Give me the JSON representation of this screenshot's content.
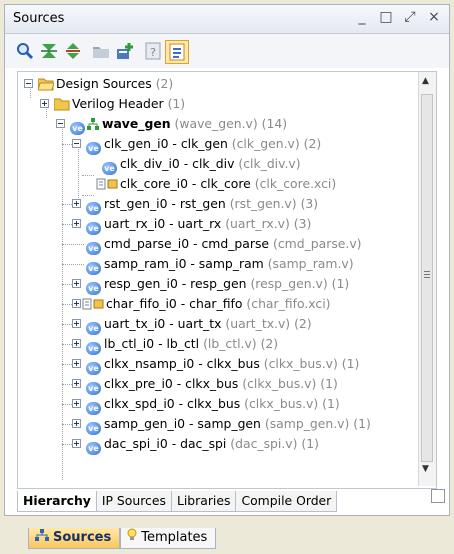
{
  "panel": {
    "title": "Sources"
  },
  "window_buttons": [
    "_",
    "□",
    "⤢",
    "×"
  ],
  "tree": {
    "design_sources": {
      "label": "Design Sources",
      "count": "(2)"
    },
    "verilog_header": {
      "label": "Verilog Header",
      "count": "(1)"
    },
    "top": {
      "name": "wave_gen",
      "file": "(wave_gen.v)",
      "count": "(14)"
    },
    "children": [
      {
        "name": "clk_gen_i0 - clk_gen",
        "file": "(clk_gen.v)",
        "count": "(2)"
      },
      {
        "name": "clk_div_i0 - clk_div",
        "file": "(clk_div.v)",
        "count": ""
      },
      {
        "name": "clk_core_i0 - clk_core",
        "file": "(clk_core.xci)",
        "count": ""
      },
      {
        "name": "rst_gen_i0 - rst_gen",
        "file": "(rst_gen.v)",
        "count": "(3)"
      },
      {
        "name": "uart_rx_i0 - uart_rx",
        "file": "(uart_rx.v)",
        "count": "(3)"
      },
      {
        "name": "cmd_parse_i0 - cmd_parse",
        "file": "(cmd_parse.v)",
        "count": ""
      },
      {
        "name": "samp_ram_i0 - samp_ram",
        "file": "(samp_ram.v)",
        "count": ""
      },
      {
        "name": "resp_gen_i0 - resp_gen",
        "file": "(resp_gen.v)",
        "count": "(1)"
      },
      {
        "name": "char_fifo_i0 - char_fifo",
        "file": "(char_fifo.xci)",
        "count": ""
      },
      {
        "name": "uart_tx_i0 - uart_tx",
        "file": "(uart_tx.v)",
        "count": "(2)"
      },
      {
        "name": "lb_ctl_i0 - lb_ctl",
        "file": "(lb_ctl.v)",
        "count": "(2)"
      },
      {
        "name": "clkx_nsamp_i0 - clkx_bus",
        "file": "(clkx_bus.v)",
        "count": "(1)"
      },
      {
        "name": "clkx_pre_i0 - clkx_bus",
        "file": "(clkx_bus.v)",
        "count": "(1)"
      },
      {
        "name": "clkx_spd_i0 - clkx_bus",
        "file": "(clkx_bus.v)",
        "count": "(1)"
      },
      {
        "name": "samp_gen_i0 - samp_gen",
        "file": "(samp_gen.v)",
        "count": "(1)"
      },
      {
        "name": "dac_spi_i0 - dac_spi",
        "file": "(dac_spi.v)",
        "count": "(1)"
      }
    ]
  },
  "tabs": [
    "Hierarchy",
    "IP Sources",
    "Libraries",
    "Compile Order"
  ],
  "bottom_tabs": [
    "Sources",
    "Templates"
  ]
}
